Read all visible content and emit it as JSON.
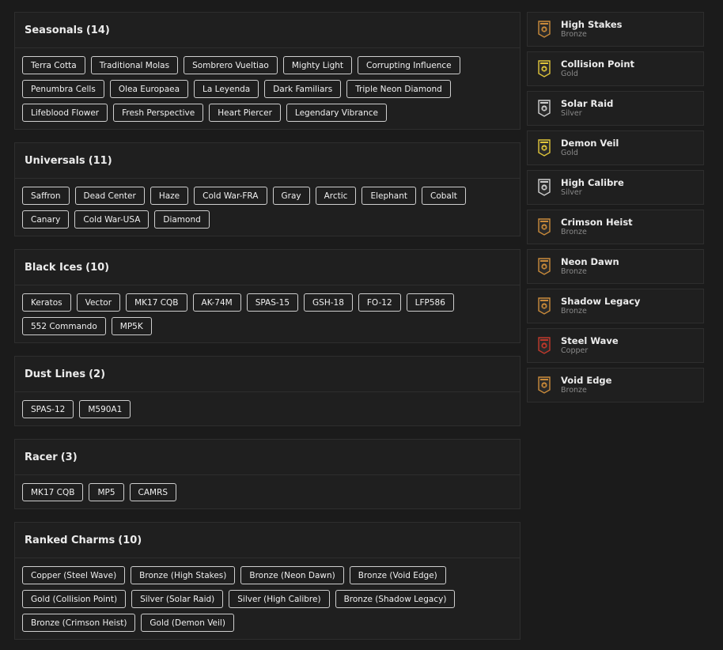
{
  "sections": [
    {
      "title": "Seasonals",
      "count": "(14)",
      "items": [
        "Terra Cotta",
        "Traditional Molas",
        "Sombrero Vueltiao",
        "Mighty Light",
        "Corrupting Influence",
        "Penumbra Cells",
        "Olea Europaea",
        "La Leyenda",
        "Dark Familiars",
        "Triple Neon Diamond",
        "Lifeblood Flower",
        "Fresh Perspective",
        "Heart Piercer",
        "Legendary Vibrance"
      ]
    },
    {
      "title": "Universals",
      "count": "(11)",
      "items": [
        "Saffron",
        "Dead Center",
        "Haze",
        "Cold War-FRA",
        "Gray",
        "Arctic",
        "Elephant",
        "Cobalt",
        "Canary",
        "Cold War-USA",
        "Diamond"
      ]
    },
    {
      "title": "Black Ices",
      "count": "(10)",
      "items": [
        "Keratos",
        "Vector",
        "MK17 CQB",
        "AK-74M",
        "SPAS-15",
        "GSH-18",
        "FO-12",
        "LFP586",
        "552 Commando",
        "MP5K"
      ]
    },
    {
      "title": "Dust Lines",
      "count": "(2)",
      "items": [
        "SPAS-12",
        "M590A1"
      ]
    },
    {
      "title": "Racer",
      "count": "(3)",
      "items": [
        "MK17 CQB",
        "MP5",
        "CAMRS"
      ]
    },
    {
      "title": "Ranked Charms",
      "count": "(10)",
      "items": [
        "Copper (Steel Wave)",
        "Bronze (High Stakes)",
        "Bronze (Neon Dawn)",
        "Bronze (Void Edge)",
        "Gold (Collision Point)",
        "Silver (Solar Raid)",
        "Silver (High Calibre)",
        "Bronze (Shadow Legacy)",
        "Bronze (Crimson Heist)",
        "Gold (Demon Veil)"
      ]
    }
  ],
  "charms": [
    {
      "name": "High Stakes",
      "tier": "Bronze",
      "icon": "bronze-charm-icon",
      "color": "#c98a3a"
    },
    {
      "name": "Collision Point",
      "tier": "Gold",
      "icon": "gold-charm-icon",
      "color": "#e0c53a"
    },
    {
      "name": "Solar Raid",
      "tier": "Silver",
      "icon": "silver-charm-icon",
      "color": "#cfcfcf"
    },
    {
      "name": "Demon Veil",
      "tier": "Gold",
      "icon": "gold-charm-icon",
      "color": "#e0c53a"
    },
    {
      "name": "High Calibre",
      "tier": "Silver",
      "icon": "silver-charm-icon",
      "color": "#cfcfcf"
    },
    {
      "name": "Crimson Heist",
      "tier": "Bronze",
      "icon": "bronze-charm-icon",
      "color": "#c98a3a"
    },
    {
      "name": "Neon Dawn",
      "tier": "Bronze",
      "icon": "bronze-charm-icon",
      "color": "#c98a3a"
    },
    {
      "name": "Shadow Legacy",
      "tier": "Bronze",
      "icon": "bronze-charm-icon",
      "color": "#c98a3a"
    },
    {
      "name": "Steel Wave",
      "tier": "Copper",
      "icon": "copper-charm-icon",
      "color": "#c0392b"
    },
    {
      "name": "Void Edge",
      "tier": "Bronze",
      "icon": "bronze-charm-icon",
      "color": "#c98a3a"
    }
  ]
}
